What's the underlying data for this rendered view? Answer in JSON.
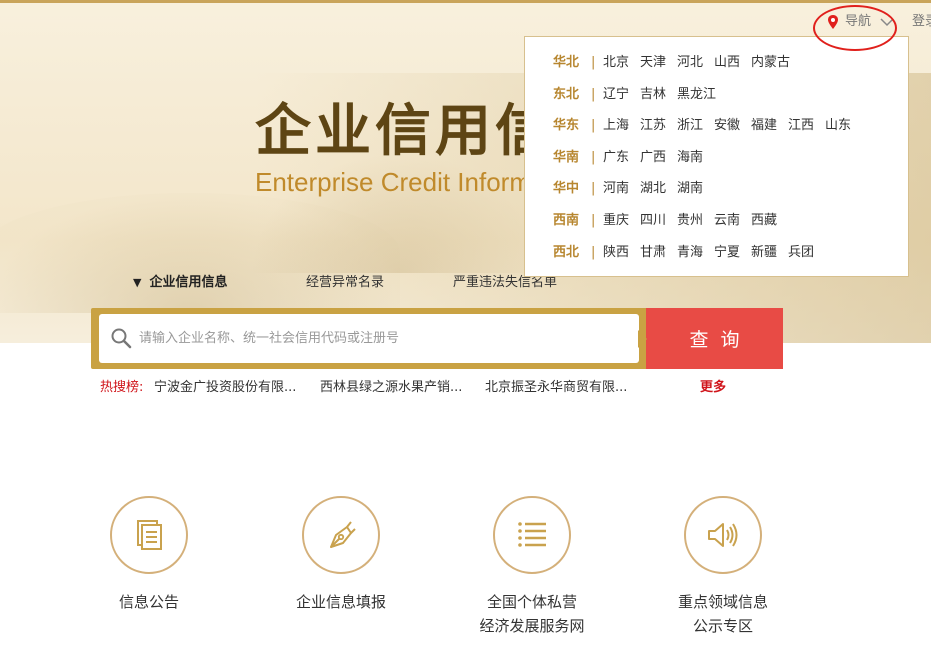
{
  "header": {
    "nav_label": "导航",
    "login_label": "登录"
  },
  "hero": {
    "title_cn": "企业信用信息公示系统",
    "title_en": "Enterprise Credit Information Publicity System"
  },
  "tabs": [
    {
      "label": "企业信用信息",
      "active": true
    },
    {
      "label": "经营异常名录",
      "active": false
    },
    {
      "label": "严重违法失信名单",
      "active": false
    }
  ],
  "search": {
    "placeholder": "请输入企业名称、统一社会信用代码或注册号",
    "button_label": "查询"
  },
  "hot_search": {
    "label": "热搜榜:",
    "items": [
      "宁波金广投资股份有限...",
      "西林县绿之源水果产销...",
      "北京振圣永华商贸有限..."
    ],
    "more_label": "更多"
  },
  "services": [
    {
      "label_lines": [
        "信息公告"
      ],
      "icon": "document-icon"
    },
    {
      "label_lines": [
        "企业信息填报"
      ],
      "icon": "pen-nib-icon"
    },
    {
      "label_lines": [
        "全国个体私营",
        "经济发展服务网"
      ],
      "icon": "list-icon"
    },
    {
      "label_lines": [
        "重点领域信息",
        "公示专区"
      ],
      "icon": "speaker-icon"
    }
  ],
  "regions": [
    {
      "name": "华北",
      "provinces": [
        "北京",
        "天津",
        "河北",
        "山西",
        "内蒙古"
      ]
    },
    {
      "name": "东北",
      "provinces": [
        "辽宁",
        "吉林",
        "黑龙江"
      ]
    },
    {
      "name": "华东",
      "provinces": [
        "上海",
        "江苏",
        "浙江",
        "安徽",
        "福建",
        "江西",
        "山东"
      ]
    },
    {
      "name": "华南",
      "provinces": [
        "广东",
        "广西",
        "海南"
      ]
    },
    {
      "name": "华中",
      "provinces": [
        "河南",
        "湖北",
        "湖南"
      ]
    },
    {
      "name": "西南",
      "provinces": [
        "重庆",
        "四川",
        "贵州",
        "云南",
        "西藏"
      ]
    },
    {
      "name": "西北",
      "provinces": [
        "陕西",
        "甘肃",
        "青海",
        "宁夏",
        "新疆",
        "兵团"
      ]
    }
  ],
  "colors": {
    "gold": "#c9a243",
    "search_button": "#e84b45",
    "hot_red": "#d0151b",
    "region_gold": "#b7862f",
    "annotation_red": "#e0201c"
  }
}
